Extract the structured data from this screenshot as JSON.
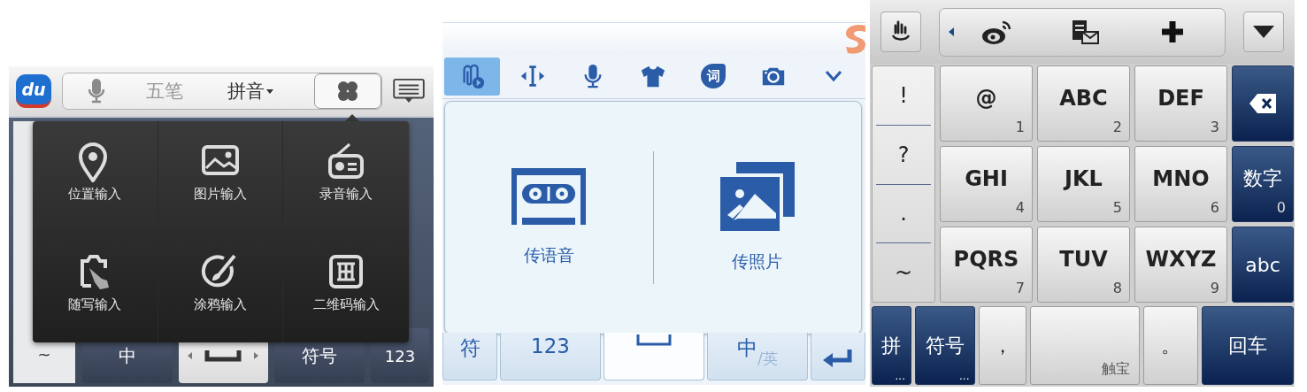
{
  "left_keyboard": {
    "toolbar": {
      "logo": "du",
      "modes": [
        {
          "label": "五笔",
          "selected": false
        },
        {
          "label": "拼音",
          "selected": true
        }
      ],
      "apps_button": {
        "expanded": true
      }
    },
    "popup_items": [
      {
        "kind": "location",
        "label": "位置输入"
      },
      {
        "kind": "image",
        "label": "图片输入"
      },
      {
        "kind": "radio",
        "label": "录音输入"
      },
      {
        "kind": "handwrite",
        "label": "随写输入"
      },
      {
        "kind": "brush",
        "label": "涂鸦输入"
      },
      {
        "kind": "qrcode",
        "label": "二维码输入"
      }
    ],
    "side_key": "~",
    "bottom_keys": [
      {
        "kind": "text",
        "label": "中"
      },
      {
        "kind": "space"
      },
      {
        "kind": "text",
        "label": "符号"
      },
      {
        "kind": "text",
        "label": "123"
      }
    ]
  },
  "middle_keyboard": {
    "toolbar": {
      "tools": [
        {
          "kind": "attach",
          "selected": true
        },
        {
          "kind": "cursor",
          "selected": false
        },
        {
          "kind": "mic",
          "selected": false
        },
        {
          "kind": "shirt",
          "selected": false
        },
        {
          "kind": "hot-word",
          "label": "词",
          "selected": false
        },
        {
          "kind": "camera",
          "selected": false
        },
        {
          "kind": "collapse",
          "selected": false
        }
      ]
    },
    "panel_options": [
      {
        "kind": "voice",
        "label": "传语音"
      },
      {
        "kind": "photo",
        "label": "传照片"
      }
    ],
    "bottom_keys": [
      {
        "kind": "text",
        "label": "符"
      },
      {
        "kind": "text",
        "label": "123"
      },
      {
        "kind": "space"
      },
      {
        "kind": "lang",
        "label": "中",
        "sub": "/英"
      },
      {
        "kind": "enter"
      }
    ]
  },
  "right_keyboard": {
    "toolbar": {
      "items": [
        {
          "kind": "weibo"
        },
        {
          "kind": "sms"
        },
        {
          "kind": "plus"
        }
      ]
    },
    "side_keys": [
      "!",
      "?",
      ".",
      "~"
    ],
    "letter_keys": [
      {
        "letters": "@",
        "digit": "1"
      },
      {
        "letters": "ABC",
        "digit": "2"
      },
      {
        "letters": "DEF",
        "digit": "3"
      },
      {
        "letters": "GHI",
        "digit": "4"
      },
      {
        "letters": "JKL",
        "digit": "5"
      },
      {
        "letters": "MNO",
        "digit": "6"
      },
      {
        "letters": "PQRS",
        "digit": "7"
      },
      {
        "letters": "TUV",
        "digit": "8"
      },
      {
        "letters": "WXYZ",
        "digit": "9"
      }
    ],
    "action_keys": [
      {
        "kind": "backspace"
      },
      {
        "kind": "text",
        "label": "数字",
        "digit": "0"
      },
      {
        "kind": "text",
        "label": "abc"
      }
    ],
    "bottom_keys": [
      {
        "kind": "dark",
        "label": "拼",
        "more": "..."
      },
      {
        "kind": "dark",
        "label": "符号",
        "more": "..."
      },
      {
        "kind": "light",
        "label": "，"
      },
      {
        "kind": "space",
        "label": "触宝"
      },
      {
        "kind": "light",
        "label": "。"
      },
      {
        "kind": "dark",
        "label": "回车"
      }
    ]
  }
}
